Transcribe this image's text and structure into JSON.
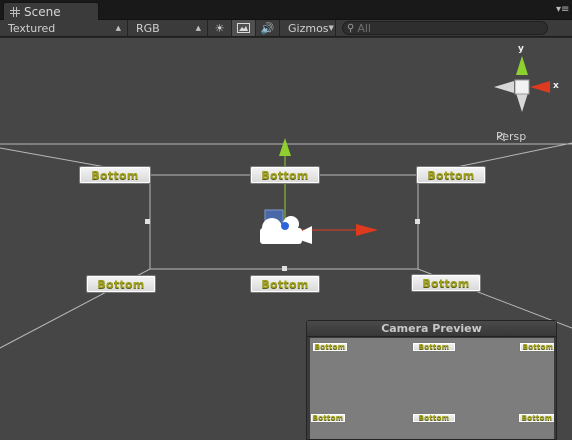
{
  "tab": {
    "label": "Scene"
  },
  "toolbar": {
    "render_mode": "Textured",
    "color_mode": "RGB",
    "gizmos_label": "Gizmos",
    "search_placeholder": "All"
  },
  "scene": {
    "persp_label": "Persp",
    "axes": {
      "y": "y",
      "x": "x"
    },
    "tag_text": "Bottom"
  },
  "camera_preview": {
    "title": "Camera Preview",
    "tag_text": "Bottom"
  },
  "colors": {
    "y_axis": "#8ed030",
    "x_axis": "#e03a1e",
    "tag_text": "#9ea01a",
    "scene_bg": "#464646"
  }
}
